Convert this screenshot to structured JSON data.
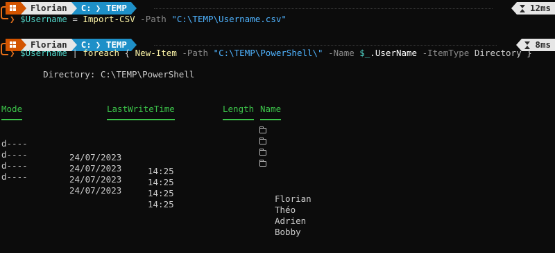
{
  "prompt1": {
    "user": "Florian",
    "drive": "C:",
    "path": "TEMP",
    "timer": "12ms"
  },
  "cmd1": {
    "var": "$Username",
    "eq": " = ",
    "cmdlet": "Import-CSV",
    "param": " -Path ",
    "value": "\"C:\\TEMP\\Username.csv\""
  },
  "prompt2": {
    "user": "Florian",
    "drive": "C:",
    "path": "TEMP",
    "timer": "8ms"
  },
  "cmd2": {
    "var": "$Username",
    "pipe": " | ",
    "foreach": "foreach",
    "brace_open": " { ",
    "cmdlet": "New-Item",
    "param1": " -Path ",
    "value1": "\"C:\\TEMP\\PowerShell\\\"",
    "param2": " -Name ",
    "var2": "$_",
    "prop": ".UserName",
    "param3": " -ItemType ",
    "value3": "Directory",
    "brace_close": " }"
  },
  "directory_line": "    Directory: C:\\TEMP\\PowerShell",
  "table": {
    "headers": {
      "mode": "Mode",
      "lastwrite": "LastWriteTime",
      "length": "Length",
      "name": "Name"
    },
    "rows": [
      {
        "mode": "d----",
        "date": "24/07/2023",
        "time": "14:25",
        "name": "Florian"
      },
      {
        "mode": "d----",
        "date": "24/07/2023",
        "time": "14:25",
        "name": "Théo"
      },
      {
        "mode": "d----",
        "date": "24/07/2023",
        "time": "14:25",
        "name": "Adrien"
      },
      {
        "mode": "d----",
        "date": "24/07/2023",
        "time": "14:25",
        "name": "Bobby"
      }
    ]
  },
  "colors": {
    "background": "#0c0c0c",
    "os_segment": "#d35400",
    "user_segment": "#e6e6e6",
    "path_segment": "#1e90c8",
    "prompt_accent": "#e8711a",
    "header_green": "#3cc44a"
  }
}
